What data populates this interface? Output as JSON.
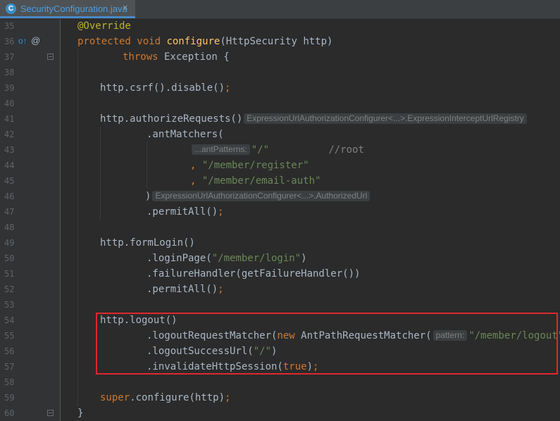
{
  "tab": {
    "icon_letter": "C",
    "file_name": "SecurityConfiguration.java",
    "close": "×"
  },
  "gutter_icons": {
    "override": "o↑",
    "annotation": "@"
  },
  "line_numbers": [
    "35",
    "36",
    "37",
    "38",
    "39",
    "40",
    "41",
    "42",
    "43",
    "44",
    "45",
    "46",
    "47",
    "48",
    "49",
    "50",
    "51",
    "52",
    "53",
    "54",
    "55",
    "56",
    "57",
    "58",
    "59",
    "60"
  ],
  "code": {
    "l35_annotation": "@Override",
    "l36_protected": "protected",
    "l36_void": "void",
    "l36_method": "configure",
    "l36_params": "(HttpSecurity http)",
    "l37_throws": "throws",
    "l37_rest": " Exception {",
    "l39_text": "http.csrf().disable()",
    "l39_semi": ";",
    "l41_text": "http.authorizeRequests()",
    "l41_hint": "ExpressionUrlAuthorizationConfigurer<...>.ExpressionInterceptUrlRegistry",
    "l42_text": ".antMatchers(",
    "l43_hint": "...antPatterns:",
    "l43_str": "\"/\"",
    "l43_comment": "//root",
    "l44_comma": ", ",
    "l44_str": "\"/member/register\"",
    "l45_comma": ", ",
    "l45_str": "\"/member/email-auth\"",
    "l46_text": ")",
    "l46_hint": "ExpressionUrlAuthorizationConfigurer<...>.AuthorizedUrl",
    "l47_text": ".permitAll()",
    "l47_semi": ";",
    "l49_text": "http.formLogin()",
    "l50_pre": ".loginPage(",
    "l50_str": "\"/member/login\"",
    "l50_post": ")",
    "l51_text": ".failureHandler(getFailureHandler())",
    "l52_text": ".permitAll()",
    "l52_semi": ";",
    "l54_text": "http.logout()",
    "l55_pre": ".logoutRequestMatcher(",
    "l55_new": "new",
    "l55_mid": " AntPathRequestMatcher(",
    "l55_hint": "pattern:",
    "l55_str": "\"/member/logout\"",
    "l55_post": "))",
    "l56_pre": ".logoutSuccessUrl(",
    "l56_str": "\"/\"",
    "l56_post": ")",
    "l57_pre": ".invalidateHttpSession(",
    "l57_true": "true",
    "l57_post": ")",
    "l57_semi": ";",
    "l59_super": "super",
    "l59_rest": ".configure(http)",
    "l59_semi": ";",
    "l60_text": "}"
  },
  "colors": {
    "background": "#2b2b2b",
    "gutter": "#313335",
    "keyword": "#cc7832",
    "method": "#ffc66d",
    "annotation": "#bbb529",
    "string": "#6a8759",
    "comment": "#808080",
    "highlight_box": "#e0272e"
  }
}
